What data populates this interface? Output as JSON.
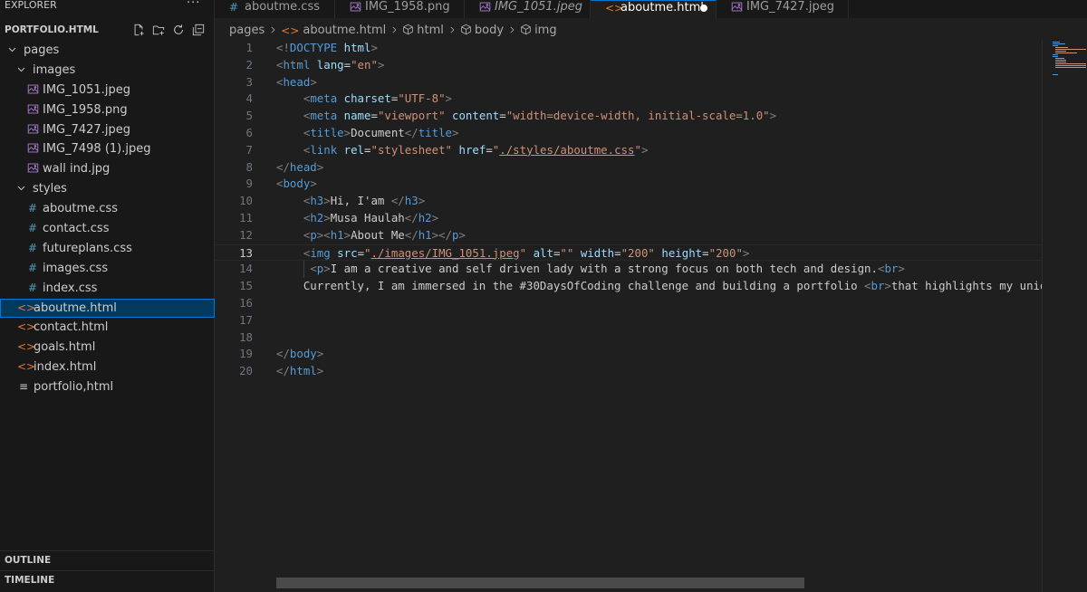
{
  "sidebar": {
    "header": "EXPLORER",
    "more_glyph": "···",
    "section_title": "PORTFOLIO.HTML",
    "tree": [
      {
        "label": "pages",
        "kind": "folder-open",
        "depth": 0
      },
      {
        "label": "images",
        "kind": "folder-open",
        "depth": 1
      },
      {
        "label": "IMG_1051.jpeg",
        "kind": "image",
        "depth": 2
      },
      {
        "label": "IMG_1958.png",
        "kind": "image",
        "depth": 2
      },
      {
        "label": "IMG_7427.jpeg",
        "kind": "image",
        "depth": 2
      },
      {
        "label": "IMG_7498 (1).jpeg",
        "kind": "image",
        "depth": 2
      },
      {
        "label": "wall ind.jpg",
        "kind": "image",
        "depth": 2
      },
      {
        "label": "styles",
        "kind": "folder-open",
        "depth": 1
      },
      {
        "label": "aboutme.css",
        "kind": "css",
        "depth": 2
      },
      {
        "label": "contact.css",
        "kind": "css",
        "depth": 2
      },
      {
        "label": "futureplans.css",
        "kind": "css",
        "depth": 2
      },
      {
        "label": "images.css",
        "kind": "css",
        "depth": 2
      },
      {
        "label": "index.css",
        "kind": "css",
        "depth": 2
      },
      {
        "label": "aboutme.html",
        "kind": "html",
        "depth": 1,
        "selected": true
      },
      {
        "label": "contact.html",
        "kind": "html",
        "depth": 1
      },
      {
        "label": "goals.html",
        "kind": "html",
        "depth": 1
      },
      {
        "label": "index.html",
        "kind": "html",
        "depth": 1
      },
      {
        "label": "portfolio,html",
        "kind": "text",
        "depth": 1
      }
    ],
    "outline_title": "OUTLINE",
    "timeline_title": "TIMELINE"
  },
  "tabs": [
    {
      "label": "aboutme.css",
      "icon": "css",
      "italic": false,
      "active": false
    },
    {
      "label": "IMG_1958.png",
      "icon": "image",
      "italic": false,
      "active": false
    },
    {
      "label": "IMG_1051.jpeg",
      "icon": "image",
      "italic": true,
      "active": false
    },
    {
      "label": "aboutme.html",
      "icon": "html",
      "italic": false,
      "active": true,
      "dirty": true
    },
    {
      "label": "IMG_7427.jpeg",
      "icon": "image",
      "italic": false,
      "active": false
    }
  ],
  "breadcrumb": {
    "items": [
      "pages",
      "aboutme.html",
      "html",
      "body",
      "img"
    ]
  },
  "editor": {
    "current_line": 13,
    "lines": [
      {
        "n": "1",
        "indent": 0,
        "toks": [
          [
            "b",
            "<!"
          ],
          [
            "t",
            "DOCTYPE"
          ],
          [
            "x",
            " "
          ],
          [
            "a",
            "html"
          ],
          [
            "b",
            ">"
          ]
        ]
      },
      {
        "n": "2",
        "indent": 0,
        "toks": [
          [
            "b",
            "<"
          ],
          [
            "t",
            "html"
          ],
          [
            "x",
            " "
          ],
          [
            "a",
            "lang"
          ],
          [
            "e",
            "="
          ],
          [
            "s",
            "\"en\""
          ],
          [
            "b",
            ">"
          ]
        ]
      },
      {
        "n": "3",
        "indent": 0,
        "toks": [
          [
            "b",
            "<"
          ],
          [
            "t",
            "head"
          ],
          [
            "b",
            ">"
          ]
        ]
      },
      {
        "n": "4",
        "indent": 1,
        "toks": [
          [
            "b",
            "<"
          ],
          [
            "t",
            "meta"
          ],
          [
            "x",
            " "
          ],
          [
            "a",
            "charset"
          ],
          [
            "e",
            "="
          ],
          [
            "s",
            "\"UTF-8\""
          ],
          [
            "b",
            ">"
          ]
        ]
      },
      {
        "n": "5",
        "indent": 1,
        "toks": [
          [
            "b",
            "<"
          ],
          [
            "t",
            "meta"
          ],
          [
            "x",
            " "
          ],
          [
            "a",
            "name"
          ],
          [
            "e",
            "="
          ],
          [
            "s",
            "\"viewport\""
          ],
          [
            "x",
            " "
          ],
          [
            "a",
            "content"
          ],
          [
            "e",
            "="
          ],
          [
            "s",
            "\"width=device-width, initial-scale=1.0\""
          ],
          [
            "b",
            ">"
          ]
        ]
      },
      {
        "n": "6",
        "indent": 1,
        "toks": [
          [
            "b",
            "<"
          ],
          [
            "t",
            "title"
          ],
          [
            "b",
            ">"
          ],
          [
            "x",
            "Document"
          ],
          [
            "b",
            "</"
          ],
          [
            "t",
            "title"
          ],
          [
            "b",
            ">"
          ]
        ]
      },
      {
        "n": "7",
        "indent": 1,
        "toks": [
          [
            "b",
            "<"
          ],
          [
            "t",
            "link"
          ],
          [
            "x",
            " "
          ],
          [
            "a",
            "rel"
          ],
          [
            "e",
            "="
          ],
          [
            "s",
            "\"stylesheet\""
          ],
          [
            "x",
            " "
          ],
          [
            "a",
            "href"
          ],
          [
            "e",
            "="
          ],
          [
            "s",
            "\""
          ],
          [
            "l",
            "./styles/aboutme.css"
          ],
          [
            "s",
            "\""
          ],
          [
            "b",
            ">"
          ]
        ]
      },
      {
        "n": "8",
        "indent": 0,
        "toks": [
          [
            "b",
            "</"
          ],
          [
            "t",
            "head"
          ],
          [
            "b",
            ">"
          ]
        ]
      },
      {
        "n": "9",
        "indent": 0,
        "toks": [
          [
            "b",
            "<"
          ],
          [
            "t",
            "body"
          ],
          [
            "b",
            ">"
          ]
        ]
      },
      {
        "n": "10",
        "indent": 1,
        "toks": [
          [
            "b",
            "<"
          ],
          [
            "t",
            "h3"
          ],
          [
            "b",
            ">"
          ],
          [
            "x",
            "Hi, I'am "
          ],
          [
            "b",
            "</"
          ],
          [
            "t",
            "h3"
          ],
          [
            "b",
            ">"
          ]
        ]
      },
      {
        "n": "11",
        "indent": 1,
        "toks": [
          [
            "b",
            "<"
          ],
          [
            "t",
            "h2"
          ],
          [
            "b",
            ">"
          ],
          [
            "x",
            "Musa Haulah"
          ],
          [
            "b",
            "</"
          ],
          [
            "t",
            "h2"
          ],
          [
            "b",
            ">"
          ]
        ]
      },
      {
        "n": "12",
        "indent": 1,
        "toks": [
          [
            "b",
            "<"
          ],
          [
            "t",
            "p"
          ],
          [
            "b",
            "><"
          ],
          [
            "t",
            "h1"
          ],
          [
            "b",
            ">"
          ],
          [
            "x",
            "About Me"
          ],
          [
            "b",
            "</"
          ],
          [
            "t",
            "h1"
          ],
          [
            "b",
            "></"
          ],
          [
            "t",
            "p"
          ],
          [
            "b",
            ">"
          ]
        ]
      },
      {
        "n": "13",
        "indent": 1,
        "toks": [
          [
            "b",
            "<"
          ],
          [
            "t",
            "img"
          ],
          [
            "x",
            " "
          ],
          [
            "a",
            "src"
          ],
          [
            "e",
            "="
          ],
          [
            "s",
            "\""
          ],
          [
            "l",
            "./images/IMG_1051.jpeg"
          ],
          [
            "s",
            "\""
          ],
          [
            "x",
            " "
          ],
          [
            "a",
            "alt"
          ],
          [
            "e",
            "="
          ],
          [
            "s",
            "\"\""
          ],
          [
            "x",
            " "
          ],
          [
            "a",
            "width"
          ],
          [
            "e",
            "="
          ],
          [
            "s",
            "\"200\""
          ],
          [
            "x",
            " "
          ],
          [
            "a",
            "height"
          ],
          [
            "e",
            "="
          ],
          [
            "s",
            "\"200\""
          ],
          [
            "b",
            ">"
          ]
        ]
      },
      {
        "n": "14",
        "indent": 1,
        "extra": " ",
        "toks": [
          [
            "b",
            "<"
          ],
          [
            "t",
            "p"
          ],
          [
            "b",
            ">"
          ],
          [
            "x",
            "I am a creative and self driven lady with a strong focus on both tech and design."
          ],
          [
            "b",
            "<"
          ],
          [
            "t",
            "br"
          ],
          [
            "b",
            ">"
          ]
        ]
      },
      {
        "n": "15",
        "indent": 1,
        "toks": [
          [
            "x",
            "Currently, I am immersed in the #30DaysOfCoding challenge and building a portfolio "
          ],
          [
            "b",
            "<"
          ],
          [
            "t",
            "br"
          ],
          [
            "b",
            ">"
          ],
          [
            "x",
            "that highlights my unique skills"
          ]
        ]
      },
      {
        "n": "16",
        "indent": 0,
        "toks": []
      },
      {
        "n": "17",
        "indent": 0,
        "toks": []
      },
      {
        "n": "18",
        "indent": 0,
        "toks": []
      },
      {
        "n": "19",
        "indent": 0,
        "toks": [
          [
            "b",
            "</"
          ],
          [
            "t",
            "body"
          ],
          [
            "b",
            ">"
          ]
        ]
      },
      {
        "n": "20",
        "indent": 0,
        "toks": [
          [
            "b",
            "</"
          ],
          [
            "t",
            "html"
          ],
          [
            "b",
            ">"
          ]
        ]
      }
    ]
  },
  "colors": {
    "accent": "#0078d4",
    "html_icon": "#e37933",
    "css_icon": "#519aba",
    "image_icon": "#a074c4"
  }
}
